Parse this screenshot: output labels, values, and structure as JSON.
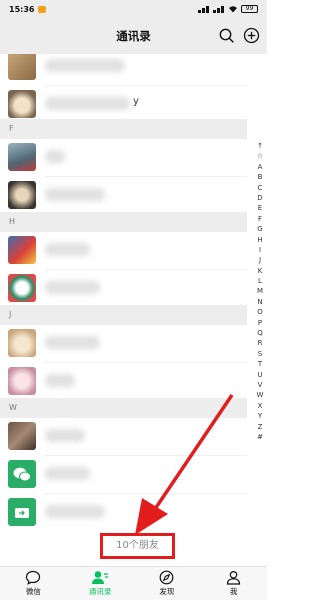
{
  "status_bar": {
    "time": "15:36",
    "battery": "99"
  },
  "header": {
    "title": "通讯录"
  },
  "sections": [
    {
      "letter": "F"
    },
    {
      "letter": "H"
    },
    {
      "letter": "J"
    },
    {
      "letter": "W"
    }
  ],
  "contacts": {
    "r0_suffix": "",
    "r1_suffix": "y"
  },
  "index_bar": [
    "↑",
    "☆",
    "A",
    "B",
    "C",
    "D",
    "E",
    "F",
    "G",
    "H",
    "I",
    "J",
    "K",
    "L",
    "M",
    "N",
    "O",
    "P",
    "Q",
    "R",
    "S",
    "T",
    "U",
    "V",
    "W",
    "X",
    "Y",
    "Z",
    "#"
  ],
  "footer": {
    "friend_count": "10个朋友"
  },
  "tabs": [
    {
      "label": "微信",
      "icon": "chat-icon"
    },
    {
      "label": "通讯录",
      "icon": "contacts-icon",
      "active": true
    },
    {
      "label": "发现",
      "icon": "compass-icon"
    },
    {
      "label": "我",
      "icon": "person-icon"
    }
  ],
  "colors": {
    "accent": "#07c160",
    "highlight": "#e21d1d",
    "background": "#ededed"
  }
}
